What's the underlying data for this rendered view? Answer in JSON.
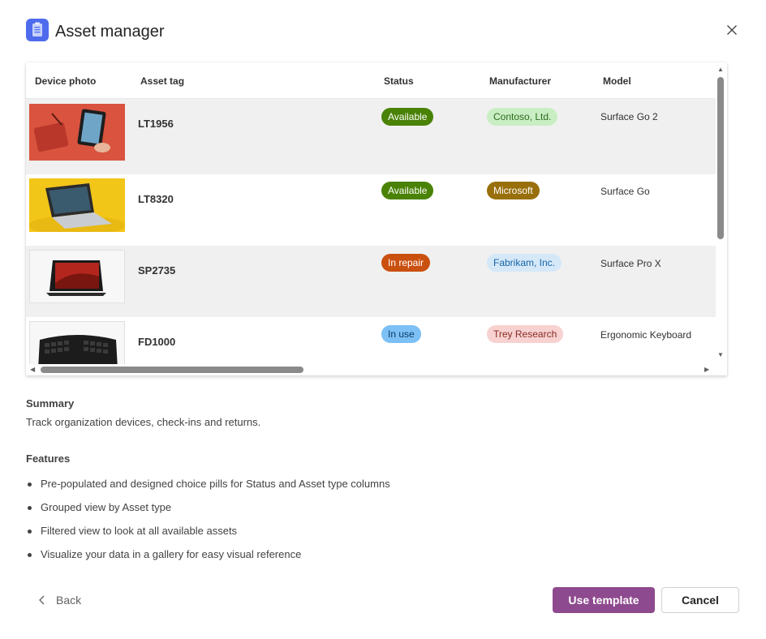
{
  "dialog": {
    "title": "Asset manager",
    "icon": "clipboard-icon",
    "close_icon": "close-icon",
    "accent_color": "#4f6bed"
  },
  "table": {
    "columns": [
      "Device photo",
      "Asset tag",
      "Status",
      "Manufacturer",
      "Model"
    ],
    "rows": [
      {
        "photo": "surface-go-2-photo",
        "asset_tag": "LT1956",
        "status": "Available",
        "manufacturer": "Contoso, Ltd.",
        "model": "Surface Go 2"
      },
      {
        "photo": "surface-go-photo",
        "asset_tag": "LT8320",
        "status": "Available",
        "manufacturer": "Microsoft",
        "model": "Surface Go"
      },
      {
        "photo": "surface-pro-x-photo",
        "asset_tag": "SP2735",
        "status": "In repair",
        "manufacturer": "Fabrikam, Inc.",
        "model": "Surface Pro X"
      },
      {
        "photo": "ergonomic-keyboard-photo",
        "asset_tag": "FD1000",
        "status": "In use",
        "manufacturer": "Trey Research",
        "model": "Ergonomic Keyboard"
      }
    ],
    "status_colors": {
      "Available": {
        "bg": "#498205",
        "fg": "#ffffff"
      },
      "In repair": {
        "bg": "#ca5010",
        "fg": "#ffffff"
      },
      "In use": {
        "bg": "#7cc0f5",
        "fg": "#0a3a66"
      }
    },
    "manufacturer_colors": {
      "Contoso, Ltd.": {
        "bg": "#c9eec3",
        "fg": "#2d6b1f"
      },
      "Microsoft": {
        "bg": "#986f0b",
        "fg": "#ffffff"
      },
      "Fabrikam, Inc.": {
        "bg": "#d5e8f8",
        "fg": "#1565a8"
      },
      "Trey Research": {
        "bg": "#f7d2d0",
        "fg": "#8a2a23"
      }
    }
  },
  "summary": {
    "heading": "Summary",
    "text": "Track organization devices, check-ins and returns."
  },
  "features": {
    "heading": "Features",
    "items": [
      "Pre-populated and designed choice pills for Status and Asset type columns",
      "Grouped view by Asset type",
      "Filtered view to look at all available assets",
      "Visualize your data in a gallery for easy visual reference"
    ]
  },
  "footer": {
    "back_label": "Back",
    "primary_label": "Use template",
    "secondary_label": "Cancel",
    "primary_color": "#8e4a8e"
  }
}
